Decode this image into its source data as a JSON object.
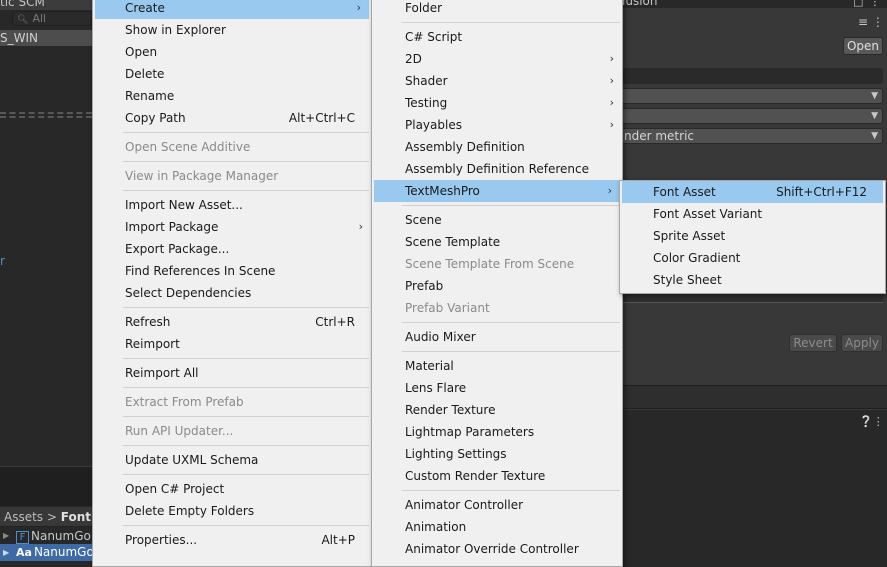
{
  "background": {
    "left_title": "tic SCM",
    "search_placeholder": "All",
    "selected_item": "S_WIN",
    "blue_text": "r",
    "breadcrumb": {
      "root": "Assets",
      "sep": ">",
      "current": "Font"
    },
    "files": [
      "NanumGo",
      "NanumGothic"
    ],
    "right_title": "lusion",
    "open_button": "Open",
    "field_render_metric": "nder metric",
    "revert_button": "Revert",
    "apply_button": "Apply"
  },
  "menu_main": {
    "items": [
      {
        "label": "Create",
        "submenu": true,
        "highlighted": true
      },
      {
        "label": "Show in Explorer"
      },
      {
        "label": "Open"
      },
      {
        "label": "Delete"
      },
      {
        "label": "Rename"
      },
      {
        "label": "Copy Path",
        "shortcut": "Alt+Ctrl+C"
      },
      {
        "sep": true
      },
      {
        "label": "Open Scene Additive",
        "disabled": true
      },
      {
        "sep": true
      },
      {
        "label": "View in Package Manager",
        "disabled": true
      },
      {
        "sep": true
      },
      {
        "label": "Import New Asset..."
      },
      {
        "label": "Import Package",
        "submenu": true
      },
      {
        "label": "Export Package..."
      },
      {
        "label": "Find References In Scene"
      },
      {
        "label": "Select Dependencies"
      },
      {
        "sep": true
      },
      {
        "label": "Refresh",
        "shortcut": "Ctrl+R"
      },
      {
        "label": "Reimport"
      },
      {
        "sep": true
      },
      {
        "label": "Reimport All"
      },
      {
        "sep": true
      },
      {
        "label": "Extract From Prefab",
        "disabled": true
      },
      {
        "sep": true
      },
      {
        "label": "Run API Updater...",
        "disabled": true
      },
      {
        "sep": true
      },
      {
        "label": "Update UXML Schema"
      },
      {
        "sep": true
      },
      {
        "label": "Open C# Project"
      },
      {
        "label": "Delete Empty Folders"
      },
      {
        "sep": true
      },
      {
        "label": "Properties...",
        "shortcut": "Alt+P"
      }
    ]
  },
  "menu_create": {
    "items": [
      {
        "label": "Folder"
      },
      {
        "sep": true
      },
      {
        "label": "C# Script"
      },
      {
        "label": "2D",
        "submenu": true
      },
      {
        "label": "Shader",
        "submenu": true
      },
      {
        "label": "Testing",
        "submenu": true
      },
      {
        "label": "Playables",
        "submenu": true
      },
      {
        "label": "Assembly Definition"
      },
      {
        "label": "Assembly Definition Reference"
      },
      {
        "label": "TextMeshPro",
        "submenu": true,
        "highlighted": true
      },
      {
        "sep": true
      },
      {
        "label": "Scene"
      },
      {
        "label": "Scene Template"
      },
      {
        "label": "Scene Template From Scene",
        "disabled": true
      },
      {
        "label": "Prefab"
      },
      {
        "label": "Prefab Variant",
        "disabled": true
      },
      {
        "sep": true
      },
      {
        "label": "Audio Mixer"
      },
      {
        "sep": true
      },
      {
        "label": "Material"
      },
      {
        "label": "Lens Flare"
      },
      {
        "label": "Render Texture"
      },
      {
        "label": "Lightmap Parameters"
      },
      {
        "label": "Lighting Settings"
      },
      {
        "label": "Custom Render Texture"
      },
      {
        "sep": true
      },
      {
        "label": "Animator Controller"
      },
      {
        "label": "Animation"
      },
      {
        "label": "Animator Override Controller"
      }
    ]
  },
  "menu_textmeshpro": {
    "items": [
      {
        "label": "Font Asset",
        "shortcut": "Shift+Ctrl+F12",
        "highlighted": true
      },
      {
        "label": "Font Asset Variant"
      },
      {
        "label": "Sprite Asset"
      },
      {
        "label": "Color Gradient"
      },
      {
        "label": "Style Sheet"
      }
    ]
  },
  "colors": {
    "menu_bg": "#f0f0f0",
    "highlight": "#99c9ef",
    "editor_bg": "#282828",
    "selection_blue": "#3e6aa6"
  }
}
